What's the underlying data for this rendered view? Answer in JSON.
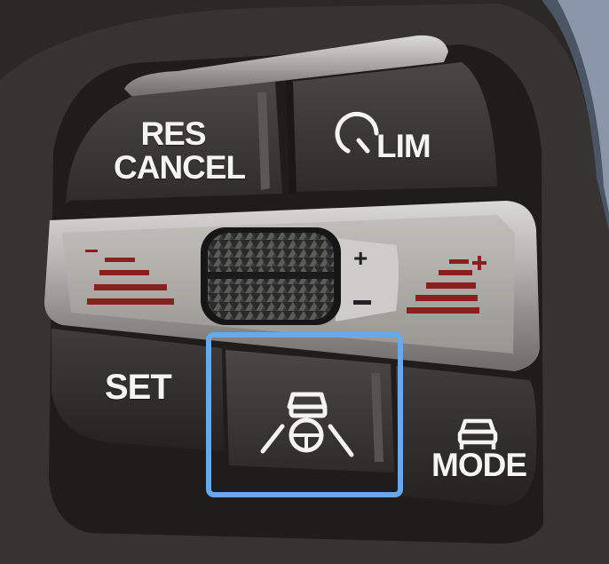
{
  "buttons": {
    "res_label": "RES",
    "cancel_label": "CANCEL",
    "lim_label": "LIM",
    "set_label": "SET",
    "mode_label": "MODE",
    "plus_label": "+",
    "minus_label": "−"
  },
  "icons": {
    "lim": "speedometer-icon",
    "assist": "driving-assistant-icon",
    "mode": "car-front-icon"
  },
  "colors": {
    "highlight": "#6aa8e6",
    "accent_red": "#8b1e1e",
    "label": "#f4f4f2"
  }
}
